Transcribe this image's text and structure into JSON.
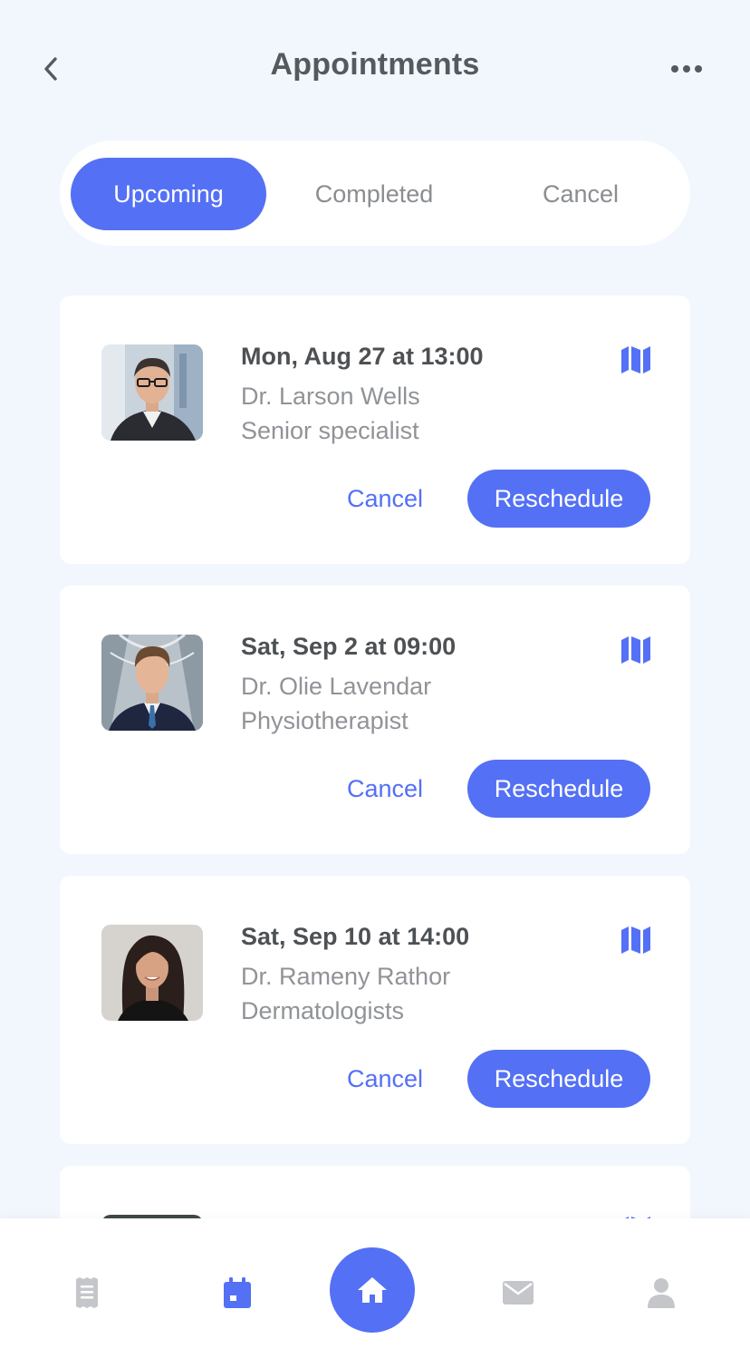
{
  "header": {
    "title": "Appointments",
    "back_icon": "chevron-left-icon",
    "more_icon": "more-horizontal-icon"
  },
  "tabs": [
    {
      "label": "Upcoming",
      "active": true
    },
    {
      "label": "Completed",
      "active": false
    },
    {
      "label": "Cancel",
      "active": false
    }
  ],
  "appointments": [
    {
      "date": "Mon, Aug 27 at 13:00",
      "doctor": "Dr. Larson Wells",
      "role": "Senior specialist",
      "cancel_label": "Cancel",
      "reschedule_label": "Reschedule"
    },
    {
      "date": "Sat, Sep 2 at 09:00",
      "doctor": "Dr. Olie Lavendar",
      "role": "Physiotherapist",
      "cancel_label": "Cancel",
      "reschedule_label": "Reschedule"
    },
    {
      "date": "Sat, Sep 10 at 14:00",
      "doctor": "Dr. Rameny Rathor",
      "role": "Dermatologists",
      "cancel_label": "Cancel",
      "reschedule_label": "Reschedule"
    }
  ],
  "bottom_nav": [
    {
      "icon": "receipt-icon",
      "active": false
    },
    {
      "icon": "calendar-icon",
      "active": true
    },
    {
      "icon": "home-icon",
      "active": true
    },
    {
      "icon": "mail-icon",
      "active": false
    },
    {
      "icon": "user-icon",
      "active": false
    }
  ],
  "colors": {
    "accent": "#5470f5",
    "background": "#f2f7fd",
    "card": "#ffffff",
    "muted_text": "#909397",
    "inactive_icon": "#c4c6c9"
  }
}
